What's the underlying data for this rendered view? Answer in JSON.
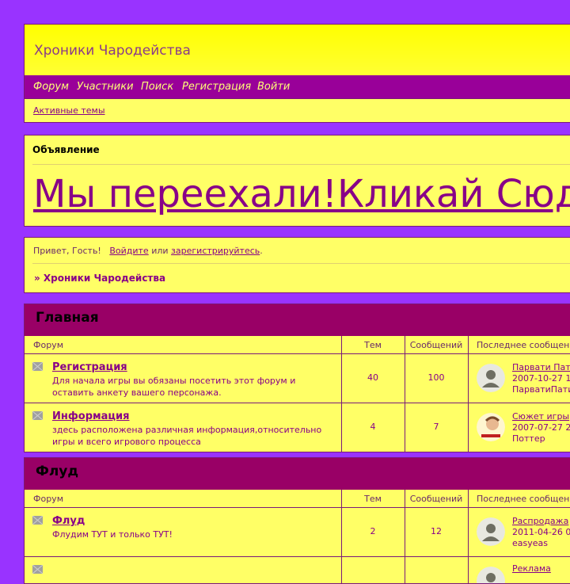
{
  "header": {
    "site_title": "Хроники Чародейства",
    "nav": [
      "Форум",
      "Участники",
      "Поиск",
      "Регистрация",
      "Войти"
    ],
    "active_topics": "Активные темы"
  },
  "announcement": {
    "heading": "Объявление",
    "text": "Мы переехали!Кликай Сюда"
  },
  "welcome": {
    "greeting": "Привет, Гость!",
    "login": "Войдите",
    "or": "или",
    "register": "зарегистрируйтесь",
    "dot": ".",
    "breadcrumb": "» Хроники Чародейства"
  },
  "columns": {
    "forum": "Форум",
    "topics": "Тем",
    "posts": "Сообщений",
    "last_post": "Последнее сообщение"
  },
  "sections": [
    {
      "title": "Главная",
      "forums": [
        {
          "name": "Регистрация",
          "description": "Для начала игры вы обязаны посетить этот форум и оставить анкету вашего персонажа.",
          "topics": "40",
          "posts": "100",
          "last_title": "Парвати Патил",
          "last_date": "2007-10-27 1",
          "last_author": "ПарватиПатил"
        },
        {
          "name": "Информация",
          "description": "здесь расположена различная информация,относительно игры и всего игрового процесса",
          "topics": "4",
          "posts": "7",
          "last_title": "Сюжет игры",
          "last_date": "2007-07-27 2",
          "last_author": "Поттер"
        }
      ]
    },
    {
      "title": "Флуд",
      "forums": [
        {
          "name": "Флуд",
          "description": "Флудим ТУТ и только ТУТ!",
          "topics": "2",
          "posts": "12",
          "last_title": "Распродажа",
          "last_date": "2011-04-26 0",
          "last_author": "easyeas"
        },
        {
          "name": "",
          "description": "",
          "topics": "",
          "posts": "",
          "last_title": "Реклама",
          "last_date": "",
          "last_author": ""
        }
      ]
    }
  ],
  "colors": {
    "page_bg": "#9933ff",
    "panel_bg": "#ffff66",
    "nav_bg": "#990099",
    "section_head_bg": "#990066",
    "link": "#880088"
  },
  "icons": {
    "forum_status": "forum-read-icon",
    "avatar_default": "default-avatar-icon"
  }
}
